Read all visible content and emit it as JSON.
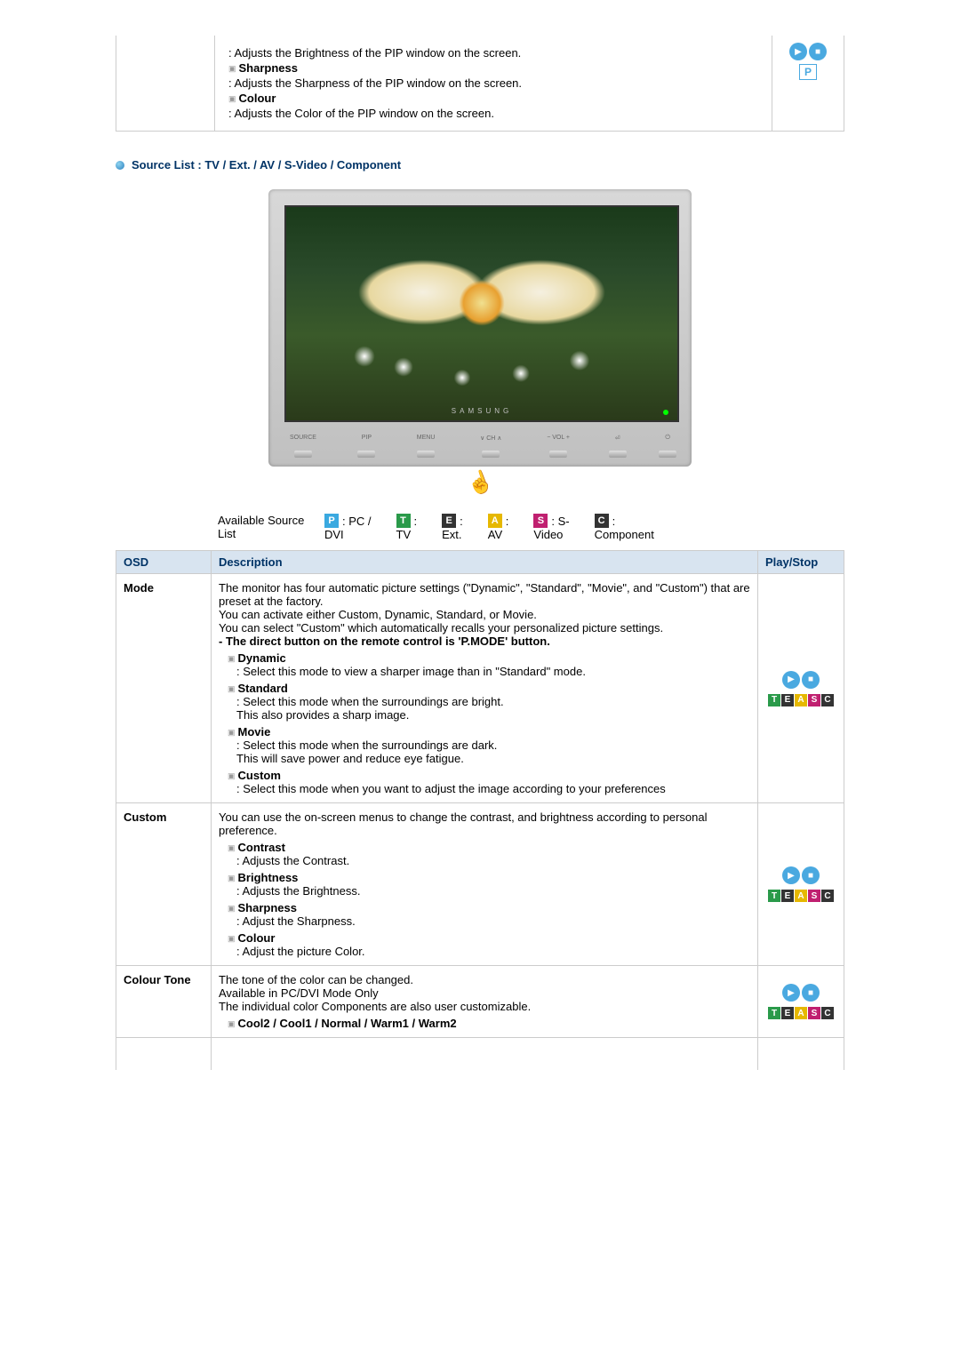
{
  "top_section": {
    "brightness_desc": ": Adjusts the Brightness of the PIP window on the screen.",
    "sharpness_label": "Sharpness",
    "sharpness_desc": ": Adjusts the Sharpness of the PIP window on the screen.",
    "colour_label": "Colour",
    "colour_desc": ": Adjusts the Color of the PIP window on the screen.",
    "p_badge": "P"
  },
  "source_heading": "Source List : TV / Ext. / AV / S-Video / Component",
  "monitor": {
    "brand": "SAMSUNG",
    "buttons": [
      "SOURCE",
      "PIP",
      "MENU",
      "∨  CH  ∧",
      "−   VOL  +",
      "⏎",
      "⏻"
    ]
  },
  "source_legend": {
    "label_line1": "Available Source",
    "label_line2": "List",
    "items": [
      {
        "badge": "P",
        "cls": "badge-p",
        "line1": ": PC /",
        "line2": "DVI"
      },
      {
        "badge": "T",
        "cls": "badge-t",
        "line1": ":",
        "line2": "TV"
      },
      {
        "badge": "E",
        "cls": "badge-e",
        "line1": ":",
        "line2": "Ext."
      },
      {
        "badge": "A",
        "cls": "badge-a",
        "line1": ":",
        "line2": "AV"
      },
      {
        "badge": "S",
        "cls": "badge-s",
        "line1": ": S-",
        "line2": "Video"
      },
      {
        "badge": "C",
        "cls": "badge-c",
        "line1": ":",
        "line2": "Component"
      }
    ]
  },
  "table": {
    "headers": {
      "osd": "OSD",
      "desc": "Description",
      "play": "Play/Stop"
    },
    "rows": [
      {
        "osd": "Mode",
        "intro": "The monitor has four automatic picture settings (\"Dynamic\", \"Standard\", \"Movie\", and \"Custom\") that are preset at the factory.\nYou can activate either Custom, Dynamic, Standard, or Movie.\nYou can select \"Custom\" which automatically recalls your personalized picture settings.",
        "note": "- The direct button on the remote control is 'P.MODE' button.",
        "items": [
          {
            "title": "Dynamic",
            "desc": ": Select this mode to view a sharper image than in \"Standard\" mode."
          },
          {
            "title": "Standard",
            "desc": ": Select this mode when the surroundings are bright.\nThis also provides a sharp image."
          },
          {
            "title": "Movie",
            "desc": ": Select this mode when the surroundings are dark.\nThis will save power and reduce eye fatigue."
          },
          {
            "title": "Custom",
            "desc": ": Select this mode when you want to adjust the image according to your preferences"
          }
        ],
        "badges": [
          "T",
          "E",
          "A",
          "S",
          "C"
        ]
      },
      {
        "osd": "Custom",
        "intro": "You can use the on-screen menus to change the contrast, and brightness according to personal preference.",
        "items": [
          {
            "title": "Contrast",
            "desc": ": Adjusts the Contrast."
          },
          {
            "title": "Brightness",
            "desc": ": Adjusts the Brightness."
          },
          {
            "title": "Sharpness",
            "desc": ": Adjust the Sharpness."
          },
          {
            "title": "Colour",
            "desc": ": Adjust the picture Color."
          }
        ],
        "badges": [
          "T",
          "E",
          "A",
          "S",
          "C"
        ]
      },
      {
        "osd": "Colour Tone",
        "intro": "The tone of the color can be changed.\nAvailable in PC/DVI Mode Only\nThe individual color Components are also user customizable.",
        "items": [
          {
            "title": "Cool2 / Cool1 / Normal / Warm1 / Warm2",
            "desc": ""
          }
        ],
        "badges": [
          "T",
          "E",
          "A",
          "S",
          "C"
        ]
      }
    ]
  }
}
